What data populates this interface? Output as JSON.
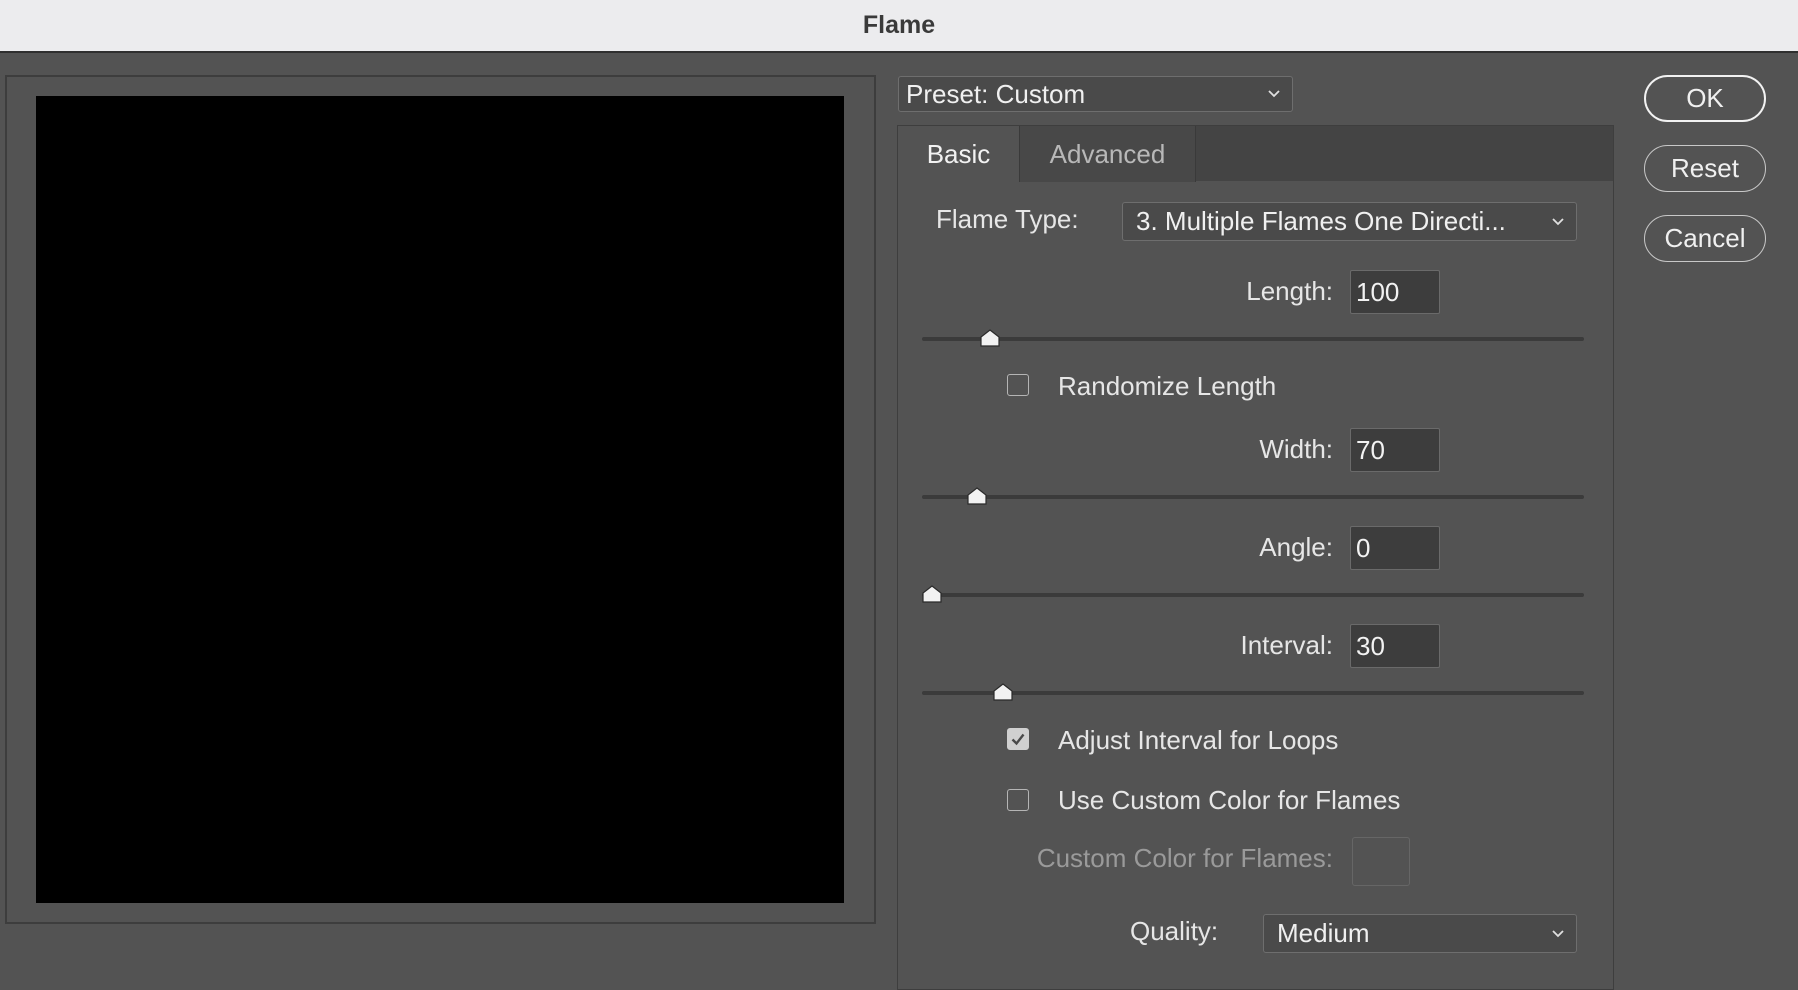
{
  "window": {
    "title": "Flame"
  },
  "preset": {
    "value": "Preset: Custom"
  },
  "tabs": {
    "basic": "Basic",
    "advanced": "Advanced"
  },
  "flame_type": {
    "label": "Flame Type:",
    "value": "3. Multiple Flames One Directi..."
  },
  "length": {
    "label": "Length:",
    "value": "100",
    "slider_level": 0.09
  },
  "randomize_length": {
    "label": "Randomize Length",
    "checked": false
  },
  "width": {
    "label": "Width:",
    "value": "70",
    "slider_level": 0.07
  },
  "angle": {
    "label": "Angle:",
    "value": "0",
    "slider_level": 0.0
  },
  "interval": {
    "label": "Interval:",
    "value": "30",
    "slider_level": 0.11
  },
  "adjust_interval": {
    "label": "Adjust Interval for Loops",
    "checked": true
  },
  "custom_color_checkbox": {
    "label": "Use Custom Color for Flames",
    "checked": false
  },
  "custom_color": {
    "label": "Custom Color for Flames:"
  },
  "quality": {
    "label": "Quality:",
    "value": "Medium"
  },
  "buttons": {
    "ok": "OK",
    "reset": "Reset",
    "cancel": "Cancel"
  }
}
